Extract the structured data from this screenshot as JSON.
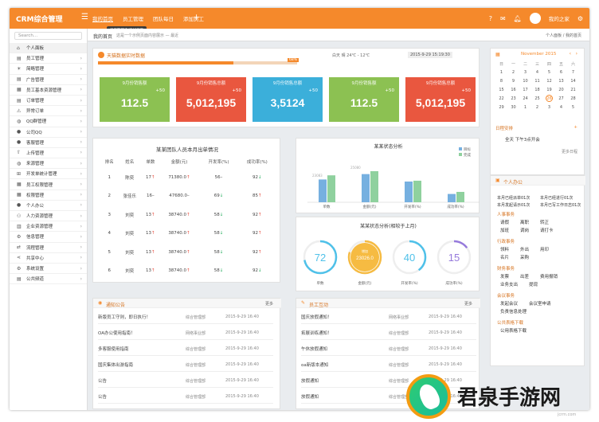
{
  "app": {
    "logo": "CRM综合管理",
    "menu_icon": "hamburger-icon"
  },
  "topnav": [
    "我的首页",
    "员工管理",
    "团队每日",
    "添加员工"
  ],
  "tooltip": "员工管理表/添加员工",
  "user": {
    "name": "我的之家"
  },
  "sidebar": {
    "search_placeholder": "Search...",
    "items": [
      {
        "label": "个人面板",
        "icon": "home-icon"
      },
      {
        "label": "员工管理",
        "icon": "doc-icon"
      },
      {
        "label": "简略管理",
        "icon": "bulb-icon"
      },
      {
        "label": "广告管理",
        "icon": "doc-icon"
      },
      {
        "label": "员工基本资源管理",
        "icon": "clipboard-icon"
      },
      {
        "label": "订单管理",
        "icon": "doc-icon"
      },
      {
        "label": "异常订单",
        "icon": "warning-icon"
      },
      {
        "label": "QQ群管理",
        "icon": "globe-icon"
      },
      {
        "label": "公司QQ",
        "icon": "user-icon"
      },
      {
        "label": "客服管理",
        "icon": "user-icon"
      },
      {
        "label": "上传管理",
        "icon": "upload-icon"
      },
      {
        "label": "来源管理",
        "icon": "globe-icon"
      },
      {
        "label": "开发单统计管理",
        "icon": "cart-icon"
      },
      {
        "label": "员工权限管理",
        "icon": "clipboard-icon"
      },
      {
        "label": "权限管理",
        "icon": "clipboard-icon"
      },
      {
        "label": "个人办公",
        "icon": "user-icon"
      },
      {
        "label": "人力资源管理",
        "icon": "users-icon"
      },
      {
        "label": "企业资源管理",
        "icon": "building-icon"
      },
      {
        "label": "信息管理",
        "icon": "gear-icon"
      },
      {
        "label": "流程管理",
        "icon": "flow-icon"
      },
      {
        "label": "共享中心",
        "icon": "share-icon"
      },
      {
        "label": "系统设置",
        "icon": "gear-icon"
      },
      {
        "label": "公共频道",
        "icon": "doc-icon"
      }
    ]
  },
  "breadcrumb": {
    "title": "我的首页",
    "desc": "这是一个示例页面内容展示 — 最近",
    "path": "个人面板 / 我的首页"
  },
  "realtime": {
    "title": "天猫数据实时数据",
    "weather": "白天 晴 24℃ - 12℃",
    "time": "2015-9-29 15:19:30",
    "progress_label": "68%",
    "progress_value": 0.68,
    "stats": [
      {
        "label": "9月份销售额",
        "sub": "+50",
        "value": "112.5",
        "color": "#8cc152"
      },
      {
        "label": "9月份销售总额",
        "sub": "+50",
        "value": "5,012,195",
        "color": "#e9573f"
      },
      {
        "label": "9月份销售总额",
        "sub": "+50",
        "value": "3,5124",
        "color": "#3bafda"
      },
      {
        "label": "9月份销售额",
        "sub": "+50",
        "value": "112.5",
        "color": "#8cc152"
      },
      {
        "label": "9月份销售总额",
        "sub": "+50",
        "value": "5,012,195",
        "color": "#e9573f"
      }
    ]
  },
  "team": {
    "title": "某某团队人员本月出单情况",
    "headers": [
      "排名",
      "姓名",
      "单数",
      "金额(元)",
      "开发率(%)",
      "成功率(%)"
    ],
    "rows": [
      {
        "rank": "1",
        "name": "陈奕",
        "count": "17",
        "ca": "↑",
        "amount": "71380.0",
        "aa": "↑",
        "dev": "56",
        "da": "–",
        "succ": "92",
        "sa": "↓"
      },
      {
        "rank": "2",
        "name": "张佳乐",
        "count": "16",
        "ca": "–",
        "amount": "47680.0",
        "aa": "–",
        "dev": "69",
        "da": "↓",
        "succ": "85",
        "sa": "↑"
      },
      {
        "rank": "3",
        "name": "刘奕",
        "count": "13",
        "ca": "↑",
        "amount": "38740.0",
        "aa": "↑",
        "dev": "58",
        "da": "↓",
        "succ": "92",
        "sa": "↑"
      },
      {
        "rank": "4",
        "name": "刘奕",
        "count": "13",
        "ca": "↑",
        "amount": "38740.0",
        "aa": "↑",
        "dev": "58",
        "da": "↓",
        "succ": "92",
        "sa": "↑"
      },
      {
        "rank": "5",
        "name": "刘奕",
        "count": "13",
        "ca": "↑",
        "amount": "38740.0",
        "aa": "↑",
        "dev": "58",
        "da": "↓",
        "succ": "92",
        "sa": "↑"
      },
      {
        "rank": "6",
        "name": "刘奕",
        "count": "13",
        "ca": "↑",
        "amount": "38740.0",
        "aa": "↑",
        "dev": "58",
        "da": "↓",
        "succ": "92",
        "sa": "↓"
      }
    ]
  },
  "chart_data": [
    {
      "type": "bar",
      "title": "某某状态分析",
      "categories": [
        "单数",
        "金额(元)",
        "开发率(%)",
        "成功率(%)"
      ],
      "series": [
        {
          "name": "目标",
          "color": "#76b0e0",
          "values": [
            55,
            68,
            50,
            20
          ]
        },
        {
          "name": "完成",
          "color": "#8fd19e",
          "values": [
            65,
            75,
            52,
            25
          ]
        }
      ],
      "annotations": [
        "23083",
        "25080"
      ]
    },
    {
      "type": "gauge",
      "title": "某某状态分析(相较于上月)",
      "items": [
        {
          "label": "单数",
          "value": "72",
          "fraction": 0.72,
          "color": "#4fc1e9"
        },
        {
          "label": "金额(元)",
          "value": "23026.0",
          "fraction": 0.8,
          "color": "#f6bb42",
          "badge": "增加"
        },
        {
          "label": "开发率(%)",
          "value": "40",
          "fraction": 0.4,
          "color": "#4fc1e9"
        },
        {
          "label": "成功率(%)",
          "value": "15",
          "fraction": 0.15,
          "color": "#967adc"
        }
      ]
    }
  ],
  "notices": {
    "title": "通知公告",
    "more": "更多",
    "rows": [
      {
        "title": "新版员工守则，即日执行！",
        "dept": "综合管理部",
        "time": "2015-9-29 16:40"
      },
      {
        "title": "OA办公使用指南！",
        "dept": "网络事业部",
        "time": "2015-9-29 16:40"
      },
      {
        "title": "多客服使用指南",
        "dept": "综合管理部",
        "time": "2015-9-29 16:40"
      },
      {
        "title": "国庆集体出游指南",
        "dept": "综合管理部",
        "time": "2015-9-29 16:40"
      },
      {
        "title": "公告",
        "dept": "综合管理部",
        "time": "2015-9-29 16:40"
      },
      {
        "title": "公告",
        "dept": "综合管理部",
        "time": "2015-9-29 16:40"
      }
    ]
  },
  "activities": {
    "title": "员工互动",
    "more": "更多",
    "rows": [
      {
        "title": "国庆放假通知！",
        "dept": "网络事业部",
        "time": "2015-9-29 16:40"
      },
      {
        "title": "拓展训练通知！",
        "dept": "综合管理部",
        "time": "2015-9-29 16:40"
      },
      {
        "title": "午休放假通知",
        "dept": "综合管理部",
        "time": "2015-9-29 16:40"
      },
      {
        "title": "oa新版本通知",
        "dept": "综合管理部",
        "time": "2015-9-29 16:40"
      },
      {
        "title": "放假通知",
        "dept": "综合管理部",
        "time": "2015-9-29 16:40"
      },
      {
        "title": "放假通知",
        "dept": "综合管理部",
        "time": "2015-9-29 16:40"
      }
    ]
  },
  "calendar": {
    "month": "November 2015",
    "weekdays": [
      "日",
      "一",
      "二",
      "三",
      "四",
      "五",
      "六"
    ],
    "weeks": [
      [
        "1",
        "2",
        "3",
        "4",
        "5",
        "6",
        "7"
      ],
      [
        "8",
        "9",
        "10",
        "11",
        "12",
        "13",
        "14"
      ],
      [
        "15",
        "16",
        "17",
        "18",
        "19",
        "20",
        "21"
      ],
      [
        "22",
        "23",
        "24",
        "25",
        "26",
        "27",
        "28"
      ],
      [
        "29",
        "30",
        "1",
        "2",
        "3",
        "4",
        "5"
      ]
    ],
    "today": "26",
    "schedule_title": "日程安排",
    "schedule_item": "全天  下午3点开会",
    "schedule_more": "更多日程"
  },
  "office": {
    "title": "个人办公",
    "stats_l1": "本月已经派单01次",
    "stats_r1": "本月已经进行01次",
    "stats_l2": "本月发起请示01次",
    "stats_r2": "本月已写工作日志01次",
    "sections": [
      {
        "heading": "人事事务",
        "rows": [
          [
            "请假",
            "离职",
            "转正"
          ],
          [
            "加班",
            "调岗",
            "请打卡"
          ]
        ]
      },
      {
        "heading": "行政事务",
        "rows": [
          [
            "领料",
            "外出",
            "用印"
          ],
          [
            "名片",
            "采购"
          ]
        ]
      },
      {
        "heading": "财务事务",
        "rows": [
          [
            "发票",
            "出差",
            "费用报销"
          ],
          [
            "业务支出",
            "提现"
          ]
        ]
      },
      {
        "heading": "会议事务",
        "rows": [
          [
            "发起会议",
            "会议室申请"
          ],
          [
            "负责信息处理"
          ]
        ]
      },
      {
        "heading": "公共表格下载",
        "rows": [
          [
            "公用表格下载"
          ]
        ]
      }
    ]
  },
  "watermark": {
    "text": "君泉手游网",
    "url": "jcrm.com"
  }
}
